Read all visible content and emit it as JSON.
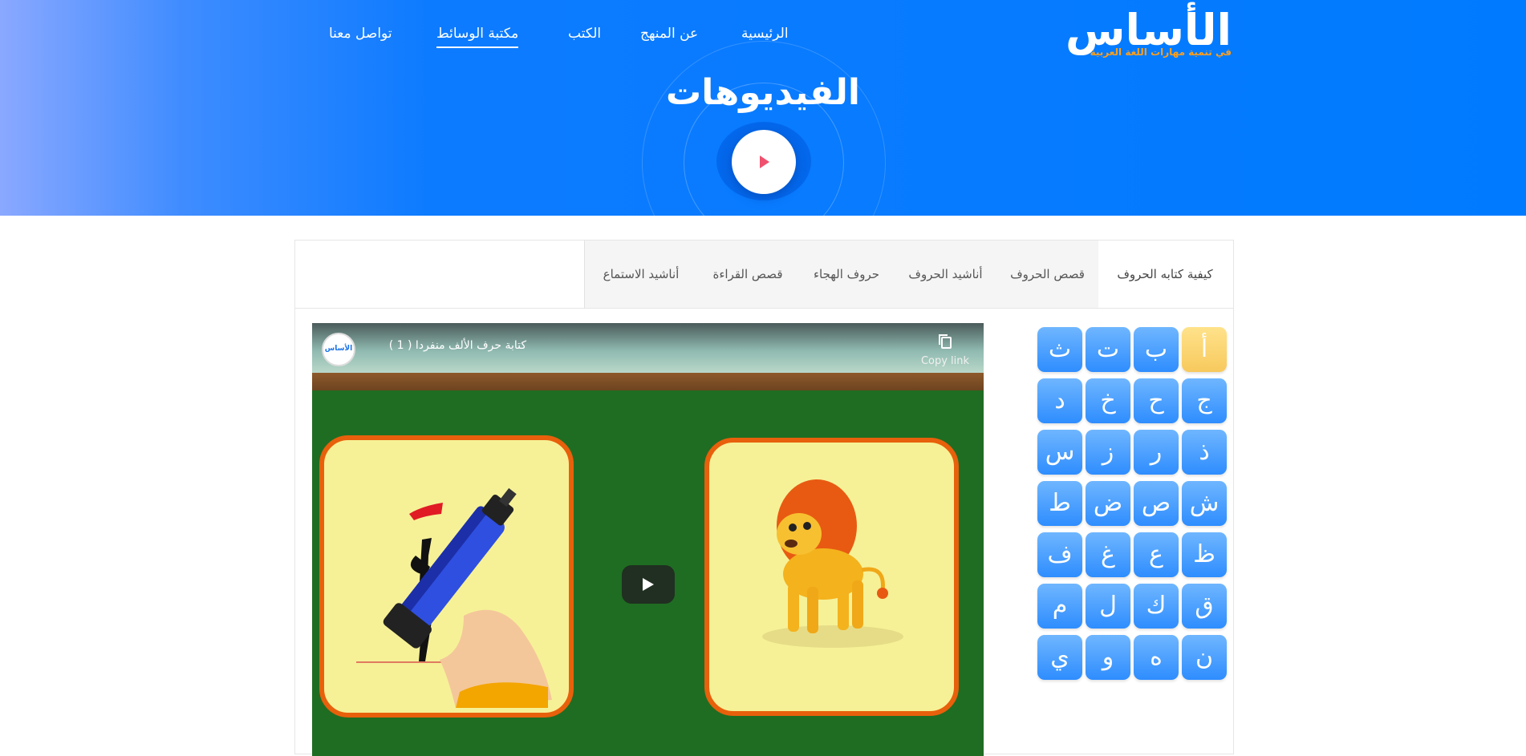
{
  "brand": {
    "logo_main": "الأساس",
    "logo_sub": "في تنمية مهارات اللغة العربية"
  },
  "nav": {
    "items": [
      {
        "label": "الرئيسية"
      },
      {
        "label": "عن المنهج"
      },
      {
        "label": "الكتب"
      },
      {
        "label": "مكتبة الوسائط",
        "active": true
      },
      {
        "label": "تواصل معنا"
      }
    ]
  },
  "hero": {
    "title": "الفيديوهات"
  },
  "tabs": [
    {
      "label": "كيفية كتابه الحروف",
      "active": true
    },
    {
      "label": "قصص الحروف"
    },
    {
      "label": "أناشيد الحروف"
    },
    {
      "label": "حروف الهجاء"
    },
    {
      "label": "قصص القراءة"
    },
    {
      "label": "أناشيد الاستماع"
    }
  ],
  "letters": [
    "أ",
    "ب",
    "ت",
    "ث",
    "ج",
    "ح",
    "خ",
    "د",
    "ذ",
    "ر",
    "ز",
    "س",
    "ش",
    "ص",
    "ض",
    "ط",
    "ظ",
    "ع",
    "غ",
    "ف",
    "ق",
    "ك",
    "ل",
    "م",
    "ن",
    "ه",
    "و",
    "ي"
  ],
  "active_letter": "أ",
  "video": {
    "title": "كتابة حرف الألف منفردا ( 1 )",
    "copy_label": "Copy link",
    "channel_avatar_text": "الأساس"
  },
  "colors": {
    "hero_blue": "#007bff",
    "letter_blue": "#2e8dff",
    "letter_active": "#f7c95d",
    "card_border": "#e8600b",
    "card_fill": "#f6f197",
    "board": "#1f6d22"
  },
  "icons": {
    "hero_play": "play-icon",
    "copy": "copy-icon",
    "video_play": "youtube-play-icon"
  }
}
